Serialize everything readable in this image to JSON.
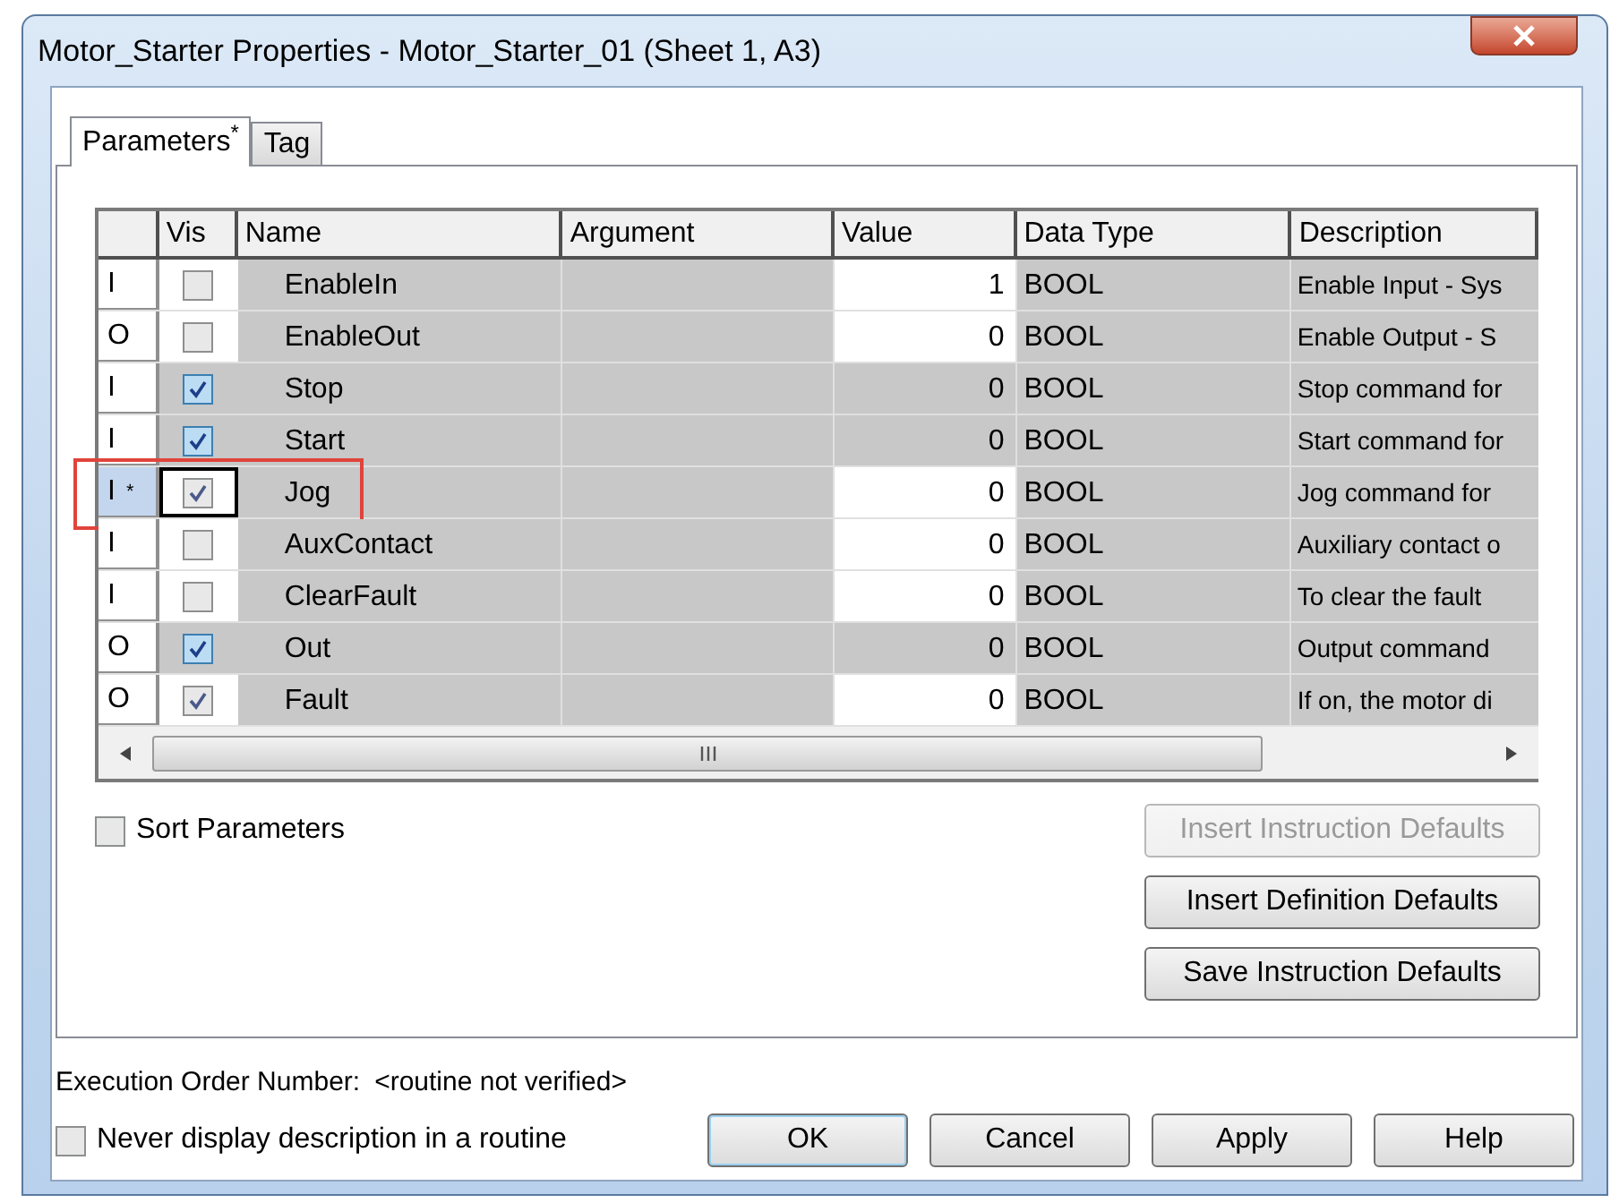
{
  "window": {
    "title": "Motor_Starter Properties - Motor_Starter_01 (Sheet 1, A3)"
  },
  "tabs": [
    {
      "label": "Parameters$^{*}$",
      "selected": true
    },
    {
      "label": "Tag",
      "selected": false
    }
  ],
  "table": {
    "columns": [
      "Vis",
      "Name",
      "Argument",
      "Value",
      "Data Type",
      "Description"
    ],
    "rows": [
      {
        "usage": "I",
        "vis": false,
        "name": "EnableIn",
        "value": "1",
        "data_type": "BOOL",
        "description": "Enable Input - Sys",
        "editable": true,
        "selected": false,
        "annotated": false
      },
      {
        "usage": "O",
        "vis": false,
        "name": "EnableOut",
        "value": "0",
        "data_type": "BOOL",
        "description": "Enable Output - S",
        "editable": true,
        "selected": false,
        "annotated": false
      },
      {
        "usage": "I",
        "vis": true,
        "name": "Stop",
        "value": "0",
        "data_type": "BOOL",
        "description": "Stop command for",
        "editable": false,
        "selected": false,
        "annotated": false
      },
      {
        "usage": "I",
        "vis": true,
        "name": "Start",
        "value": "0",
        "data_type": "BOOL",
        "description": "Start command for",
        "editable": false,
        "selected": false,
        "annotated": false
      },
      {
        "usage": "I",
        "marker": "*",
        "vis": true,
        "name": "Jog",
        "value": "0",
        "data_type": "BOOL",
        "description": "Jog command for",
        "editable": true,
        "selected": true,
        "annotated": true
      },
      {
        "usage": "I",
        "vis": false,
        "name": "AuxContact",
        "value": "0",
        "data_type": "BOOL",
        "description": "Auxiliary contact o",
        "editable": true,
        "selected": false,
        "annotated": false
      },
      {
        "usage": "I",
        "vis": false,
        "name": "ClearFault",
        "value": "0",
        "data_type": "BOOL",
        "description": "To clear the fault",
        "editable": true,
        "selected": false,
        "annotated": false
      },
      {
        "usage": "O",
        "vis": true,
        "name": "Out",
        "value": "0",
        "data_type": "BOOL",
        "description": "Output command",
        "editable": false,
        "selected": false,
        "annotated": false
      },
      {
        "usage": "O",
        "vis": true,
        "name": "Fault",
        "value": "0",
        "data_type": "BOOL",
        "description": "If on, the motor di",
        "editable": true,
        "selected": false,
        "annotated": false
      }
    ]
  },
  "sort_parameters": {
    "label": "Sort Parameters",
    "checked": false
  },
  "side_buttons": [
    {
      "label": "Insert Instruction Defaults",
      "disabled": true
    },
    {
      "label": "Insert Definition Defaults",
      "disabled": false
    },
    {
      "label": "Save Instruction Defaults",
      "disabled": false
    }
  ],
  "execution_order": {
    "label": "Execution Order Number:",
    "value": "<routine not verified>"
  },
  "never_display": {
    "label": "Never display description in a routine",
    "checked": false
  },
  "buttons": [
    {
      "label": "OK",
      "default": true
    },
    {
      "label": "Cancel",
      "default": false
    },
    {
      "label": "Apply",
      "default": false
    },
    {
      "label": "Help",
      "default": false
    }
  ]
}
